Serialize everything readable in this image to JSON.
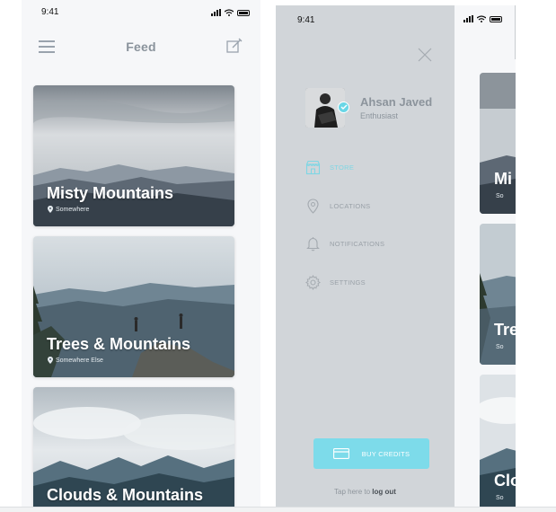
{
  "feed_screen": {
    "status_time": "9:41",
    "title": "Feed",
    "menu_icon": "hamburger-icon",
    "compose_icon": "compose-icon",
    "cards": [
      {
        "title": "Misty Mountains",
        "location": "Somewhere"
      },
      {
        "title": "Trees & Mountains",
        "location": "Somewhere Else"
      },
      {
        "title": "Clouds & Mountains",
        "location": ""
      }
    ]
  },
  "menu_screen": {
    "status_time": "9:41",
    "close_icon": "close-icon",
    "user": {
      "name": "Ahsan Javed",
      "role": "Enthusiast",
      "verified": true
    },
    "items": [
      {
        "label": "STORE",
        "icon": "store-icon",
        "active": true
      },
      {
        "label": "LOCATIONS",
        "icon": "location-pin-icon",
        "active": false
      },
      {
        "label": "NOTIFICATIONS",
        "icon": "bell-icon",
        "active": false
      },
      {
        "label": "SETTINGS",
        "icon": "gear-icon",
        "active": false
      }
    ],
    "buy_button": {
      "label": "BUY CREDITS",
      "icon": "credit-card-icon"
    },
    "logout": {
      "prefix": "Tap here to",
      "link": "log out"
    }
  },
  "partial_screen": {
    "cards": [
      {
        "title": "Mi",
        "location": "So"
      },
      {
        "title": "Tre",
        "location": "So"
      },
      {
        "title": "Clo",
        "location": "So"
      }
    ]
  },
  "colors": {
    "accent": "#7ddbea",
    "menu_background": "#d1d5d9",
    "feed_background": "#f6f7f9",
    "muted_text": "#8c949c"
  }
}
